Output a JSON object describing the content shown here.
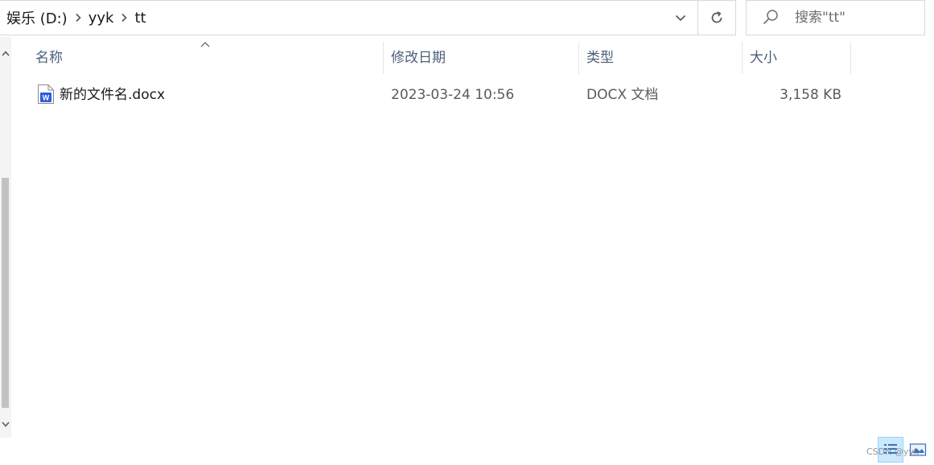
{
  "address_bar": {
    "breadcrumbs": [
      "娱乐 (D:)",
      "yyk",
      "tt"
    ]
  },
  "search": {
    "placeholder": "搜索\"tt\""
  },
  "columns": {
    "name": "名称",
    "date_modified": "修改日期",
    "type": "类型",
    "size": "大小"
  },
  "files": [
    {
      "name": "新的文件名.docx",
      "date_modified": "2023-03-24 10:56",
      "type": "DOCX 文档",
      "size": "3,158 KB",
      "icon": "word-document-icon"
    }
  ],
  "watermark": "CSDN @yyk",
  "colors": {
    "header_text": "#4c607a",
    "selected_view_bg": "#cce8ff",
    "word_icon_blue": "#2b5fd9"
  }
}
